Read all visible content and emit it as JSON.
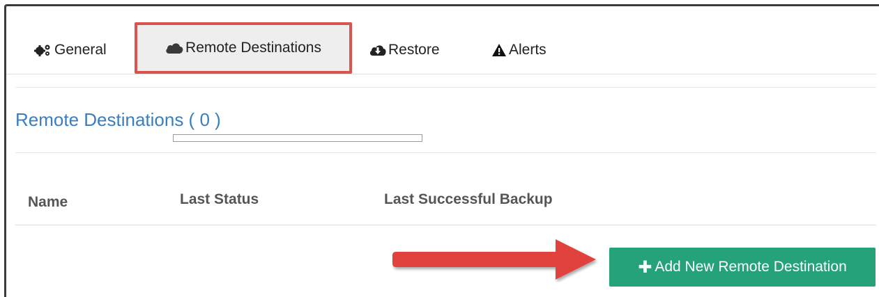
{
  "tabs": [
    {
      "label": "General",
      "icon": "gears-icon",
      "active": false
    },
    {
      "label": "Remote Destinations",
      "icon": "cloud-icon",
      "active": true
    },
    {
      "label": "Restore",
      "icon": "cloud-download-icon",
      "active": false
    },
    {
      "label": "Alerts",
      "icon": "warning-icon",
      "active": false
    }
  ],
  "section": {
    "title": "Remote Destinations ( 0 )",
    "progress": 0
  },
  "table": {
    "columns": [
      "Name",
      "Last Status",
      "Last Successful Backup"
    ],
    "rows": []
  },
  "actions": {
    "add_label": "Add New Remote Destination",
    "add_icon": "plus-icon"
  },
  "colors": {
    "accent": "#3b7ec0",
    "button": "#26a27a",
    "highlight": "#d9534f"
  }
}
